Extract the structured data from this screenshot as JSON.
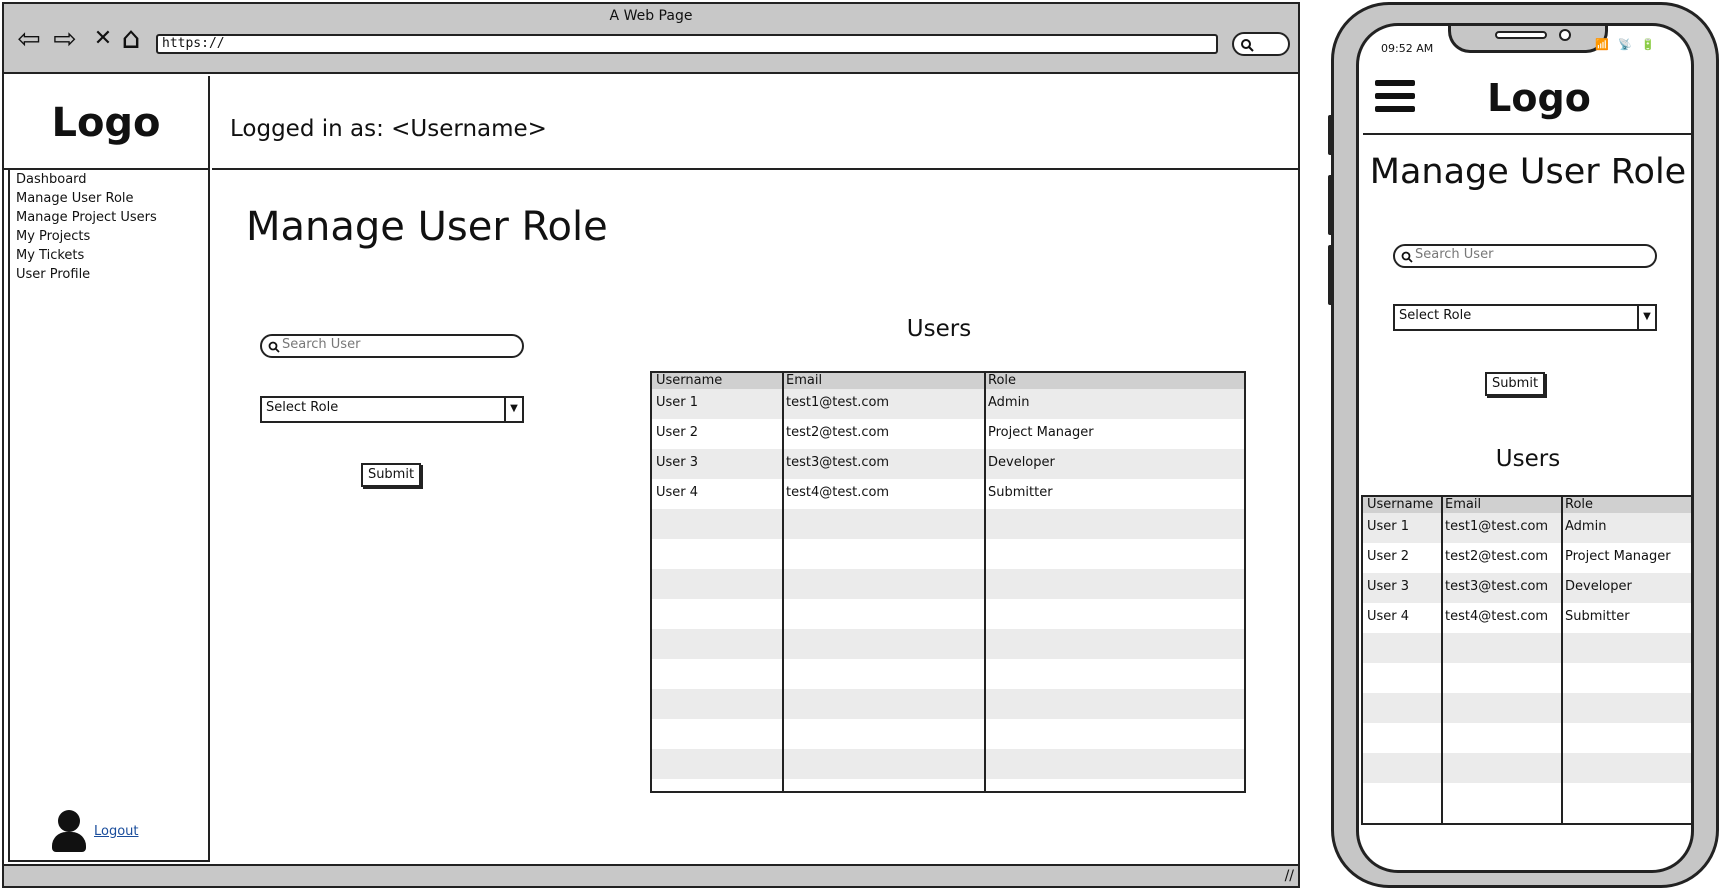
{
  "browser": {
    "window_title": "A Web Page",
    "nav_glyphs": {
      "back": "⇦",
      "forward": "⇨",
      "stop": "✕",
      "home": "⌂"
    },
    "url": "https://",
    "resize_glyph": "//"
  },
  "app": {
    "logo": "Logo",
    "logged_in": "Logged in as: <Username>",
    "nav": [
      "Dashboard",
      "Manage User Role",
      "Manage Project Users",
      "My Projects",
      "My Tickets",
      "User Profile"
    ],
    "logout": "Logout"
  },
  "main": {
    "title": "Manage User Role",
    "search_placeholder": "Search User",
    "select_role": "Select Role",
    "submit": "Submit",
    "users_title": "Users",
    "table": {
      "headers": [
        "Username",
        "Email",
        "Role"
      ],
      "rows": [
        [
          "User 1",
          "test1@test.com",
          "Admin"
        ],
        [
          "User 2",
          "test2@test.com",
          "Project Manager"
        ],
        [
          "User 3",
          "test3@test.com",
          "Developer"
        ],
        [
          "User 4",
          "test4@test.com",
          "Submitter"
        ]
      ]
    }
  },
  "mobile": {
    "time": "09:52 AM",
    "status_icons": "📶 📡 🔋",
    "logo": "Logo",
    "title": "Manage User Role",
    "search_placeholder": "Search User",
    "select_role": "Select Role",
    "submit": "Submit",
    "users_title": "Users"
  },
  "icons": {
    "search": "search-icon",
    "dropdown": "chevron-down-icon",
    "menu": "hamburger-menu-icon",
    "avatar": "user-avatar-icon"
  },
  "colors": {
    "chrome": "#c8c8c8",
    "header_row": "#d0d0d0",
    "stripe": "#ebebeb",
    "link": "#1a4d9c"
  }
}
